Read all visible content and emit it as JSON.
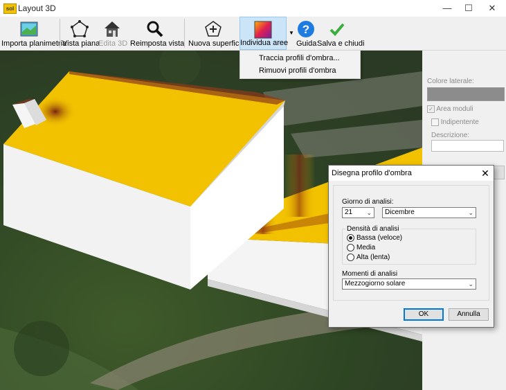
{
  "window": {
    "title": "Layout 3D",
    "icon_text": "sol"
  },
  "toolbar": {
    "import": "Importa planimetria",
    "flat_view": "Vista piana",
    "edit3d": "Edita 3D",
    "reset_view": "Reimposta vista",
    "new_surface": "Nuova superficie",
    "find_areas": "Individua aree",
    "help": "Guida",
    "save_close": "Salva e chiudi"
  },
  "dropdown_menu": {
    "items": [
      "Traccia profili d'ombra...",
      "Rimuovi profili d'ombra"
    ]
  },
  "right_panel": {
    "side_color_label": "Colore laterale:",
    "side_color": "#8c8c8c",
    "modules_area_label": "Area moduli",
    "modules_area_checked": true,
    "independent_label": "Indipentente",
    "independent_checked": false,
    "description_label": "Descrizione:",
    "description_value": ""
  },
  "dialog": {
    "title": "Disegna profilo d'ombra",
    "day_label": "Giorno di analisi:",
    "day_value": "21",
    "month_value": "Dicembre",
    "density_label": "Densità di analisi",
    "density_options": [
      "Bassa (veloce)",
      "Media",
      "Alta (lenta)"
    ],
    "density_selected": "Bassa (veloce)",
    "moments_label": "Momenti di analisi",
    "moments_value": "Mezzogiorno solare",
    "ok_label": "OK",
    "cancel_label": "Annulla"
  },
  "colors": {
    "roof": "#f2c200",
    "shadow": "#8b2a12",
    "wall": "#f2f2f2",
    "accent": "#0078d7"
  }
}
